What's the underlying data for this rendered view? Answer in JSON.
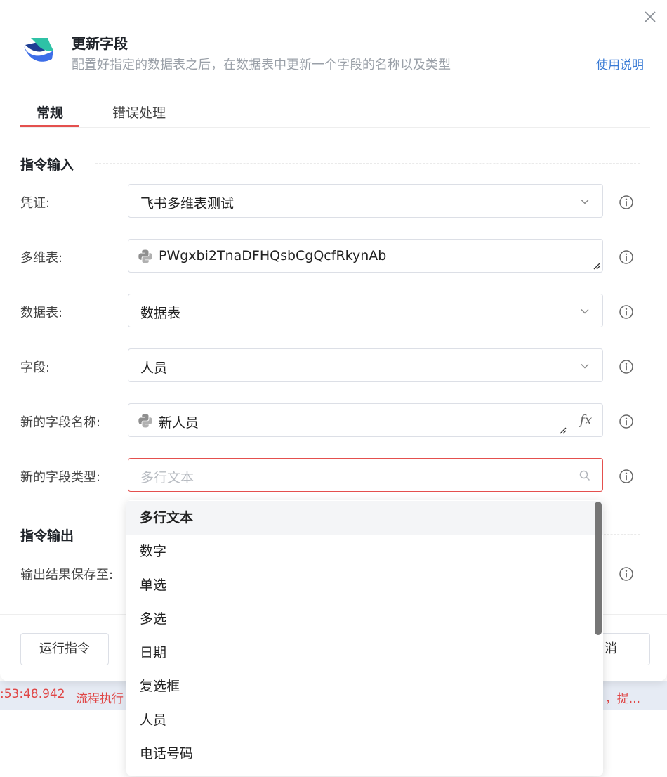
{
  "dialog": {
    "title": "更新字段",
    "subtitle": "配置好指定的数据表之后，在数据表中更新一个字段的名称以及类型",
    "help_link": "使用说明"
  },
  "tabs": [
    {
      "label": "常规",
      "active": true
    },
    {
      "label": "错误处理",
      "active": false
    }
  ],
  "sections": {
    "input": "指令输入",
    "output": "指令输出"
  },
  "fields": {
    "credential": {
      "label": "凭证:",
      "value": "飞书多维表测试"
    },
    "bitable": {
      "label": "多维表:",
      "value": "PWgxbi2TnaDFHQsbCgQcfRkynAb"
    },
    "table": {
      "label": "数据表:",
      "value": "数据表"
    },
    "field": {
      "label": "字段:",
      "value": "人员"
    },
    "new_name": {
      "label": "新的字段名称:",
      "value": "新人员",
      "fx": "fx"
    },
    "new_type": {
      "label": "新的字段类型:",
      "placeholder": "多行文本"
    },
    "output_save": {
      "label": "输出结果保存至:"
    }
  },
  "dropdown": {
    "selected": "多行文本",
    "options": [
      "多行文本",
      "数字",
      "单选",
      "多选",
      "日期",
      "复选框",
      "人员",
      "电话号码"
    ]
  },
  "footer": {
    "run_button": "运行指令",
    "cancel_button_partial": "消"
  },
  "background": {
    "log_time": ":53:48.942",
    "log_text": "流程执行",
    "log_tail": "，提..."
  },
  "colors": {
    "accent": "#e4504e",
    "link": "#3a7bd5",
    "log_error": "#e04646"
  }
}
